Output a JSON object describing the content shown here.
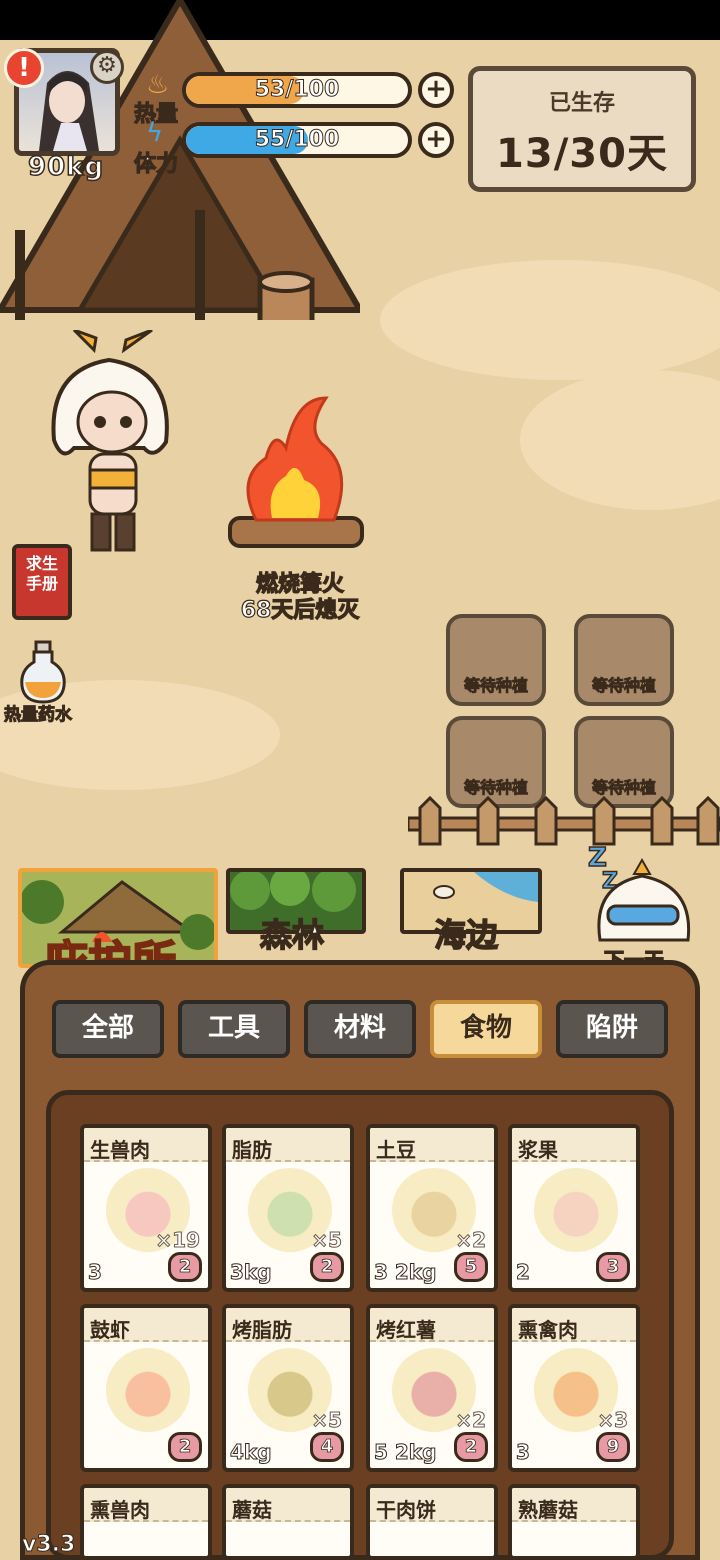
{
  "player": {
    "weight": "90kg",
    "alert_icon": "exclamation-icon",
    "settings_icon": "gear-icon"
  },
  "stats": {
    "heat": {
      "label": "热量",
      "value": "53/100",
      "fraction": 0.53,
      "color": "#f0a64a",
      "icon": "flame-icon"
    },
    "stamina": {
      "label": "体力",
      "value": "55/100",
      "fraction": 0.55,
      "color": "#3fa9e6",
      "icon": "lightning-icon"
    }
  },
  "survival": {
    "title": "已生存",
    "value": "13/30天"
  },
  "campfire": {
    "line1": "燃烧篝火",
    "line2": "68天后熄灭"
  },
  "side": {
    "guide_book": "求生\n手册",
    "potion_label": "热量药水"
  },
  "plots": [
    "等待种植",
    "等待种植",
    "等待种植",
    "等待种植"
  ],
  "locations": {
    "shelter": "庇护所",
    "forest": "森林",
    "beach": "海边",
    "next_day": "下一天"
  },
  "categories": [
    "全部",
    "工具",
    "材料",
    "食物",
    "陷阱"
  ],
  "active_category": 3,
  "items": [
    {
      "name": "生兽肉",
      "qty": "×19",
      "left": "3",
      "badge": "2"
    },
    {
      "name": "脂肪",
      "qty": "×5",
      "left": "3kg",
      "badge": "2"
    },
    {
      "name": "土豆",
      "qty": "×2",
      "left": "3 2kg",
      "badge": "5"
    },
    {
      "name": "浆果",
      "qty": "",
      "left": "2",
      "badge": "3"
    },
    {
      "name": "鼓虾",
      "qty": "",
      "left": "",
      "badge": "2"
    },
    {
      "name": "烤脂肪",
      "qty": "×5",
      "left": "4kg",
      "badge": "4"
    },
    {
      "name": "烤红薯",
      "qty": "×2",
      "left": "5 2kg",
      "badge": "2"
    },
    {
      "name": "熏禽肉",
      "qty": "×3",
      "left": "3",
      "badge": "9"
    },
    {
      "name": "熏兽肉",
      "qty": "",
      "left": "",
      "badge": ""
    },
    {
      "name": "蘑菇",
      "qty": "",
      "left": "",
      "badge": ""
    },
    {
      "name": "干肉饼",
      "qty": "",
      "left": "",
      "badge": ""
    },
    {
      "name": "熟蘑菇",
      "qty": "",
      "left": "",
      "badge": ""
    }
  ],
  "version": "v3.3"
}
